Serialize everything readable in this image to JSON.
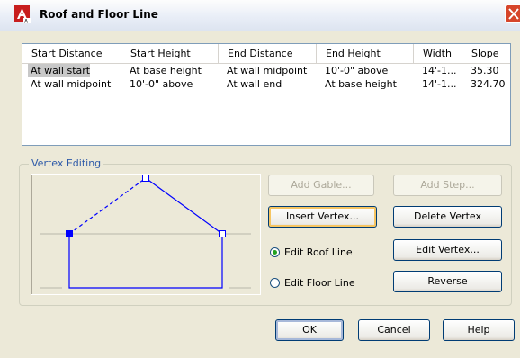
{
  "window": {
    "title": "Roof and Floor Line"
  },
  "table": {
    "columns": [
      "Start Distance",
      "Start Height",
      "End Distance",
      "End Height",
      "Width",
      "Slope"
    ],
    "rows": [
      [
        "At wall start",
        "At base height",
        "At wall midpoint",
        "10'-0\" above",
        "14'-1...",
        "35.30"
      ],
      [
        "At wall midpoint",
        "10'-0\" above",
        "At wall end",
        "At base height",
        "14'-1...",
        "324.70"
      ]
    ],
    "selected_row": 0
  },
  "vertex_editing": {
    "group_label": "Vertex Editing",
    "add_gable": "Add Gable...",
    "add_step": "Add Step...",
    "insert_vertex": "Insert Vertex...",
    "delete_vertex": "Delete Vertex",
    "edit_vertex": "Edit Vertex...",
    "reverse": "Reverse",
    "edit_roof_line": "Edit Roof Line",
    "edit_floor_line": "Edit Floor Line",
    "selected_mode": "edit_roof_line"
  },
  "footer": {
    "ok": "OK",
    "cancel": "Cancel",
    "help": "Help"
  },
  "colors": {
    "roof_line": "#0000ff",
    "accent": "#0a246a",
    "group_label": "#2e5aa8"
  }
}
